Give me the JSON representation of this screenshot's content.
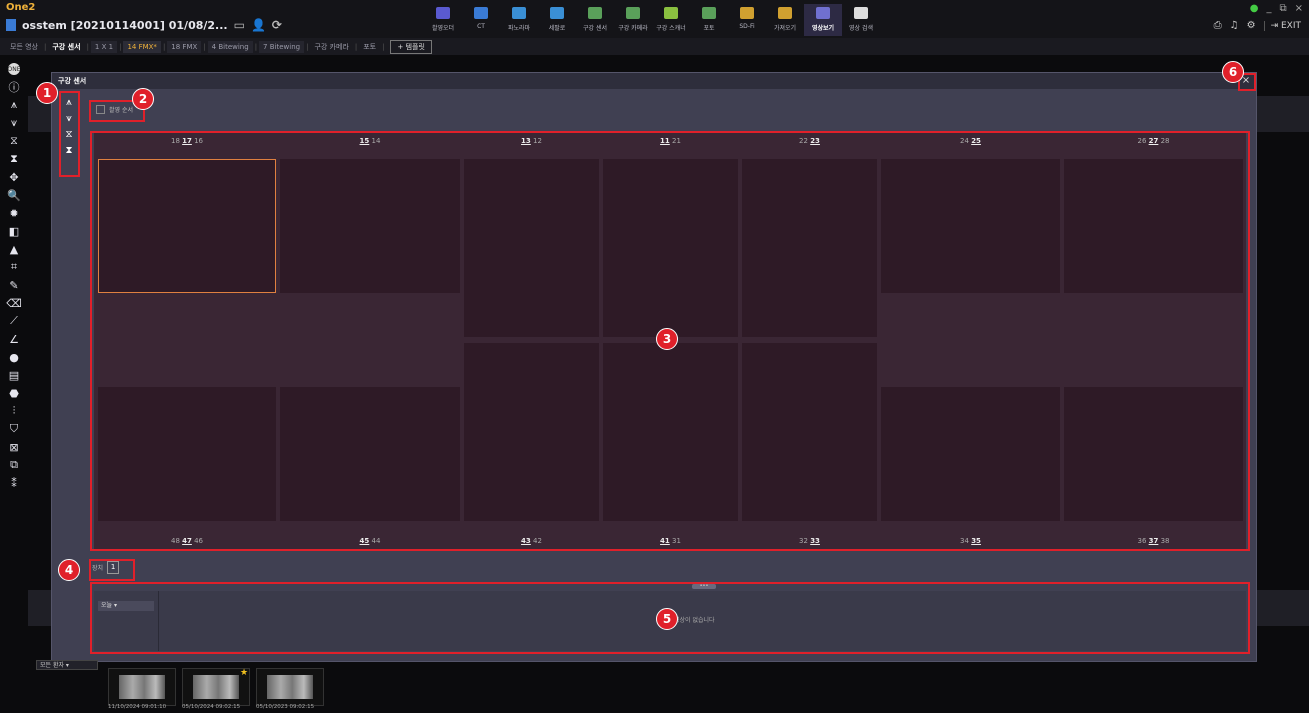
{
  "app": {
    "brand": "One2",
    "patient": "osstem  [20210114001] 01/08/2..."
  },
  "modules": [
    {
      "label": "촬영오더",
      "color": "#5a5ad0"
    },
    {
      "label": "CT",
      "color": "#3a7bd5"
    },
    {
      "label": "파노라마",
      "color": "#3a8fd5"
    },
    {
      "label": "세팔로",
      "color": "#3a8fd5"
    },
    {
      "label": "구강 센서",
      "color": "#5aa05a"
    },
    {
      "label": "구강 카메라",
      "color": "#5aa05a"
    },
    {
      "label": "구강 스캐너",
      "color": "#8ac040"
    },
    {
      "label": "포토",
      "color": "#5aa05a"
    },
    {
      "label": "SD-Fi",
      "color": "#d0a030"
    },
    {
      "label": "가져오기",
      "color": "#d0a030"
    },
    {
      "label": "영상보기",
      "color": "#7070d0"
    },
    {
      "label": "영상 검색",
      "color": "#dddddd"
    }
  ],
  "active_module": "영상보기",
  "topright": {
    "exit": "EXIT"
  },
  "tabs": {
    "items": [
      "모든 영상",
      "구강 센서",
      "1 X 1",
      "14 FMX*",
      "18 FMX",
      "4 Bitewing",
      "7 Bitewing",
      "구강 카메라",
      "포토"
    ],
    "add": "+ 템플릿"
  },
  "dialog": {
    "title": "구강 센서",
    "checkbox_label": "촬영 순서",
    "page_label": "장치",
    "page_value": "1",
    "tray_dropdown": "오늘",
    "tray_empty": "영상이 없습니다",
    "handle": "•••"
  },
  "teeth_top": [
    {
      "pre": "18 ",
      "bold": "17",
      "post": " 16"
    },
    {
      "pre": "",
      "bold": "15",
      "post": " 14"
    },
    {
      "pre": "",
      "bold": "13",
      "post": " 12"
    },
    {
      "pre": "",
      "bold": "11",
      "post": " 21"
    },
    {
      "pre": "22 ",
      "bold": "23",
      "post": ""
    },
    {
      "pre": "24 ",
      "bold": "25",
      "post": ""
    },
    {
      "pre": "26 ",
      "bold": "27",
      "post": " 28"
    }
  ],
  "teeth_bottom": [
    {
      "pre": "48 ",
      "bold": "47",
      "post": " 46"
    },
    {
      "pre": "",
      "bold": "45",
      "post": " 44"
    },
    {
      "pre": "",
      "bold": "43",
      "post": " 42"
    },
    {
      "pre": "",
      "bold": "41",
      "post": " 31"
    },
    {
      "pre": "32 ",
      "bold": "33",
      "post": ""
    },
    {
      "pre": "34 ",
      "bold": "35",
      "post": ""
    },
    {
      "pre": "36 ",
      "bold": "37",
      "post": " 38"
    }
  ],
  "bottom": {
    "dropdown": "모든 환자",
    "thumb_dates": [
      "11/10/2024  09:01:10",
      "05/10/2024  09:02:15",
      "05/10/2023  09:02:15"
    ]
  },
  "markers": [
    "1",
    "2",
    "3",
    "4",
    "5",
    "6"
  ]
}
